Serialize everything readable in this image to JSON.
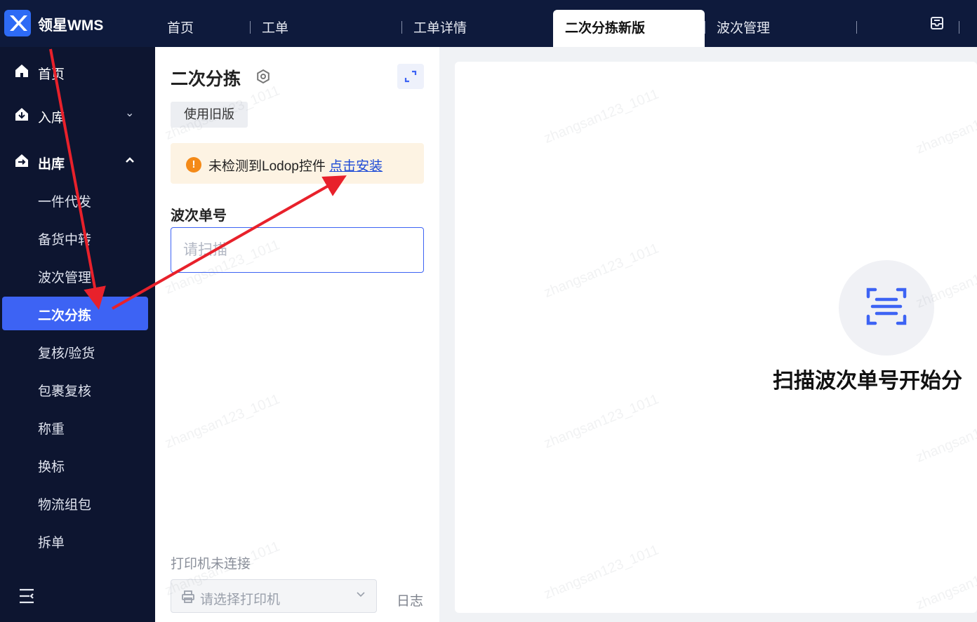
{
  "app": {
    "brand": "领星WMS"
  },
  "tabs": [
    {
      "label": "首页"
    },
    {
      "label": "工单"
    },
    {
      "label": "工单详情"
    },
    {
      "label": "二次分拣新版"
    },
    {
      "label": "波次管理"
    }
  ],
  "sidebar": {
    "home": "首页",
    "inbound": "入库",
    "outbound": "出库",
    "sub": [
      {
        "label": "一件代发"
      },
      {
        "label": "备货中转"
      },
      {
        "label": "波次管理"
      },
      {
        "label": "二次分拣"
      },
      {
        "label": "复核/验货"
      },
      {
        "label": "包裹复核"
      },
      {
        "label": "称重"
      },
      {
        "label": "换标"
      },
      {
        "label": "物流组包"
      },
      {
        "label": "拆单"
      }
    ]
  },
  "panel": {
    "title": "二次分拣",
    "old_version_button": "使用旧版",
    "alert_text": "未检测到Lodop控件",
    "alert_link": "点击安装",
    "wave_label": "波次单号",
    "wave_placeholder": "请扫描",
    "printer_status": "打印机未连接",
    "printer_placeholder": "请选择打印机",
    "log_link": "日志"
  },
  "main": {
    "scan_hint": "扫描波次单号开始分"
  },
  "watermark": "zhangsan123_1011",
  "colors": {
    "accent": "#3d63f4",
    "sidebar_bg": "#0d1530",
    "alert_bg": "#fdf3e3",
    "warning": "#f48a18",
    "annotation_arrow": "#e8212b"
  }
}
